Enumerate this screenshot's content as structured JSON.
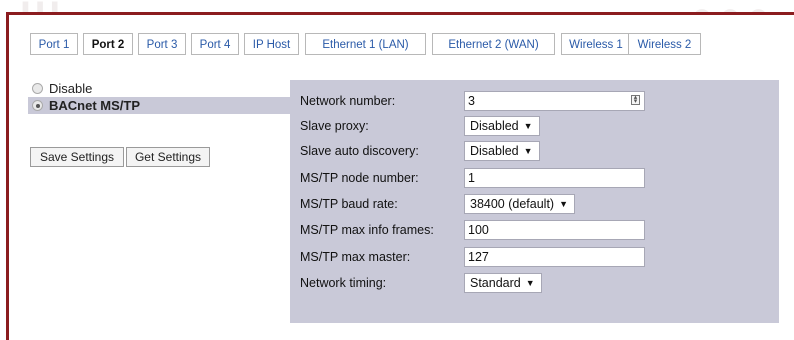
{
  "tabs": [
    {
      "label": "Port 1",
      "active": false
    },
    {
      "label": "Port 2",
      "active": true
    },
    {
      "label": "Port 3",
      "active": false
    },
    {
      "label": "Port 4",
      "active": false
    },
    {
      "label": "IP Host",
      "active": false
    },
    {
      "label": "Ethernet 1 (LAN)",
      "active": false
    },
    {
      "label": "Ethernet 2 (WAN)",
      "active": false
    },
    {
      "label": "Wireless 1",
      "active": false
    },
    {
      "label": "Wireless 2",
      "active": false
    }
  ],
  "mode": {
    "options": [
      {
        "label": "Disable",
        "checked": false
      },
      {
        "label": "BACnet MS/TP",
        "checked": true
      }
    ]
  },
  "buttons": {
    "save_label": "Save Settings",
    "get_label": "Get Settings"
  },
  "settings": {
    "network_number": {
      "label": "Network number:",
      "value": "3"
    },
    "slave_proxy": {
      "label": "Slave proxy:",
      "value": "Disabled"
    },
    "slave_auto_discovery": {
      "label": "Slave auto discovery:",
      "value": "Disabled"
    },
    "node_number": {
      "label": "MS/TP node number:",
      "value": "1"
    },
    "baud_rate": {
      "label": "MS/TP baud rate:",
      "value": "38400 (default)"
    },
    "max_info_frames": {
      "label": "MS/TP max info frames:",
      "value": "100"
    },
    "max_master": {
      "label": "MS/TP max master:",
      "value": "127"
    },
    "network_timing": {
      "label": "Network timing:",
      "value": "Standard"
    }
  },
  "colors": {
    "frame": "#8b1c1f",
    "panel": "#c9c9d8",
    "tab_link": "#2a5aa8"
  }
}
